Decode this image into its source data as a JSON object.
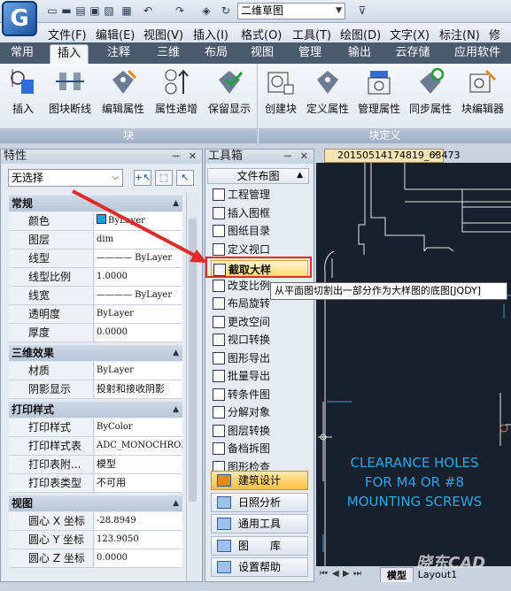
{
  "titlebar": {
    "workspace": "二维草图",
    "quick_access": [
      "new-icon",
      "open-icon",
      "save-icon",
      "save-as-icon",
      "print-icon",
      "undo-icon",
      "redo-icon",
      "layer-icon",
      "refresh-icon"
    ]
  },
  "menubar": [
    "文件(F)",
    "编辑(E)",
    "视图(V)",
    "插入(I)",
    "格式(O)",
    "工具(T)",
    "绘图(D)",
    "文字(X)",
    "标注(N)",
    "修改"
  ],
  "ribbon_tabs": [
    "常用",
    "插入",
    "注释",
    "三维",
    "布局",
    "视图",
    "管理",
    "输出",
    "云存储",
    "应用软件"
  ],
  "ribbon_active_tab": "插入",
  "ribbon": {
    "block_group": {
      "label": "块",
      "buttons": [
        "插入",
        "图块断线",
        "编辑属性",
        "属性递增",
        "保留显示"
      ]
    },
    "block_def_group": {
      "label": "块定义",
      "buttons": [
        "创建块",
        "定义属性",
        "管理属性",
        "同步属性",
        "块编辑器"
      ]
    }
  },
  "properties": {
    "title": "特性",
    "selection": "无选择",
    "sections": [
      {
        "name": "常规",
        "rows": [
          {
            "k": "颜色",
            "v": "ByLayer"
          },
          {
            "k": "图层",
            "v": "dim"
          },
          {
            "k": "线型",
            "v": "———— ByLayer"
          },
          {
            "k": "线型比例",
            "v": "1.0000"
          },
          {
            "k": "线宽",
            "v": "———— ByLayer"
          },
          {
            "k": "透明度",
            "v": "ByLayer"
          },
          {
            "k": "厚度",
            "v": "0.0000"
          }
        ]
      },
      {
        "name": "三维效果",
        "rows": [
          {
            "k": "材质",
            "v": "ByLayer"
          },
          {
            "k": "阴影显示",
            "v": "投射和接收阴影"
          }
        ]
      },
      {
        "name": "打印样式",
        "rows": [
          {
            "k": "打印样式",
            "v": "ByColor"
          },
          {
            "k": "打印样式表",
            "v": "ADC_MONOCHROM..."
          },
          {
            "k": "打印表附...",
            "v": "模型"
          },
          {
            "k": "打印表类型",
            "v": "不可用"
          }
        ]
      },
      {
        "name": "视图",
        "rows": [
          {
            "k": "圆心 X 坐标",
            "v": "-28.8949"
          },
          {
            "k": "圆心 Y 坐标",
            "v": "123.9050"
          },
          {
            "k": "圆心 Z 坐标",
            "v": "0.0000"
          }
        ]
      }
    ]
  },
  "toolbox": {
    "title": "工具箱",
    "section": "文件布图",
    "items": [
      "工程管理",
      "插入图框",
      "图纸目录",
      "定义视口",
      "截取大样",
      "改变比例",
      "布局旋转",
      "更改空间",
      "视口转换",
      "图形导出",
      "批量导出",
      "转条件图",
      "分解对象",
      "图层转换",
      "备档拆图",
      "图形检查"
    ],
    "highlighted": "截取大样",
    "footer": [
      "建筑设计",
      "日照分析",
      "通用工具",
      "图　　库",
      "设置帮助"
    ]
  },
  "tooltip": "从平面图切割出一部分作为大样图的底图[JQDY]",
  "drawing": {
    "file_tab": "20150514174819_63473",
    "annotation": [
      "CLEARANCE HOLES",
      "FOR M4 OR #8",
      "MOUNTING SCREWS"
    ],
    "layout_tabs": [
      "模型",
      "Layout1"
    ],
    "watermark": "晓东CAD"
  },
  "colors": {
    "accent": "#e32a2a",
    "highlight": "#ffd86a",
    "cad_text": "#2aa8e8",
    "canvas": "#18202e"
  }
}
